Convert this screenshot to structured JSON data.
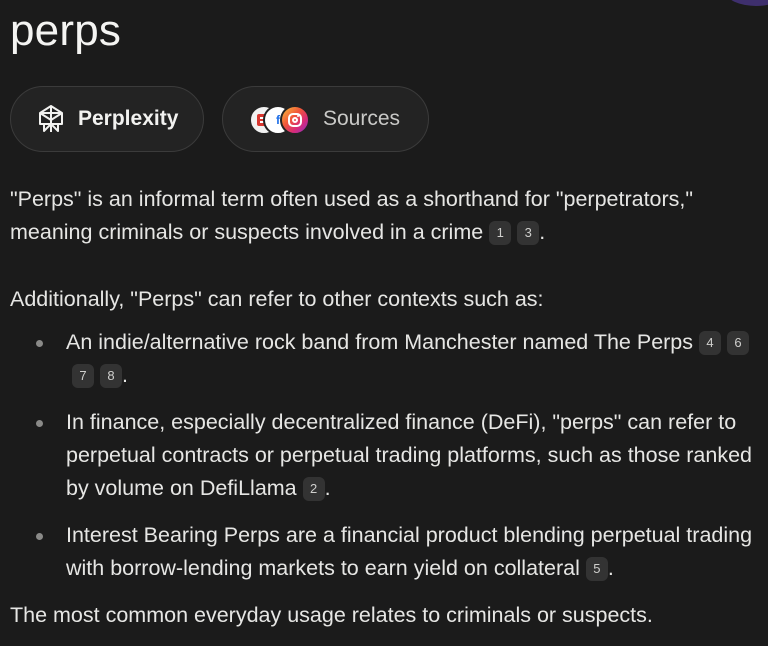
{
  "page": {
    "title": "perps"
  },
  "tabs": {
    "perplexity_label": "Perplexity",
    "perplexity_icon": "perplexity-logo-icon",
    "sources_label": "Sources",
    "source_icons": [
      "news-site-icon",
      "facebook-icon",
      "instagram-icon"
    ],
    "source_b_glyph": "f"
  },
  "answer": {
    "intro_text": "\"Perps\" is an informal term often used as a shorthand for \"perpetrators,\" meaning criminals or suspects involved in a crime",
    "intro_citations": [
      "1",
      "3"
    ],
    "additional_text": "Additionally, \"Perps\" can refer to other contexts such as:",
    "bullets": [
      {
        "text": "An indie/alternative rock band from Manchester named The Perps",
        "citations": [
          "4",
          "6",
          "7",
          "8"
        ]
      },
      {
        "text": "In finance, especially decentralized finance (DeFi), \"perps\" can refer to perpetual contracts or perpetual trading platforms, such as those ranked by volume on DefiLlama",
        "citations": [
          "2"
        ]
      },
      {
        "text": "Interest Bearing Perps are a financial product blending perpetual trading with borrow-lending markets to earn yield on collateral",
        "citations": [
          "5"
        ]
      }
    ],
    "closing_text": "The most common everyday usage relates to criminals or suspects."
  },
  "colors": {
    "background": "#1b1b1b",
    "pill_background": "#232323",
    "citation_background": "#333333",
    "accent_glow": "#5b3fb0"
  }
}
